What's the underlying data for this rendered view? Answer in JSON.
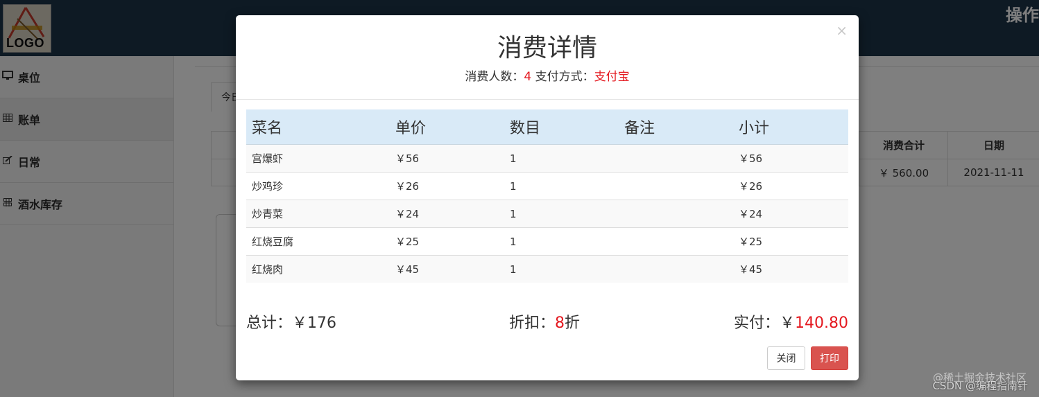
{
  "app": {
    "logo_text": "LOGO",
    "top_action": "操作"
  },
  "sidebar": {
    "items": [
      {
        "label": "桌位",
        "icon": "monitor-icon"
      },
      {
        "label": "账单",
        "icon": "table-icon"
      },
      {
        "label": "日常",
        "icon": "edit-icon"
      },
      {
        "label": "酒水库存",
        "icon": "barcode-icon"
      }
    ]
  },
  "main": {
    "tab_label": "今日",
    "table": {
      "headers": [
        "消费合计",
        "日期"
      ],
      "row": [
        "￥ 560.00",
        "2021-11-11"
      ]
    }
  },
  "modal": {
    "title": "消费详情",
    "people_label": "消费人数：",
    "people_value": "4",
    "pay_label": "支付方式：",
    "pay_value": "支付宝",
    "close_symbol": "×",
    "columns": [
      "菜名",
      "单价",
      "数目",
      "备注",
      "小计"
    ],
    "rows": [
      {
        "name": "宫爆虾",
        "price": "￥56",
        "qty": "1",
        "note": "",
        "subtotal": "￥56"
      },
      {
        "name": "炒鸡珍",
        "price": "￥26",
        "qty": "1",
        "note": "",
        "subtotal": "￥26"
      },
      {
        "name": "炒青菜",
        "price": "￥24",
        "qty": "1",
        "note": "",
        "subtotal": "￥24"
      },
      {
        "name": "红烧豆腐",
        "price": "￥25",
        "qty": "1",
        "note": "",
        "subtotal": "￥25"
      },
      {
        "name": "红烧肉",
        "price": "￥45",
        "qty": "1",
        "note": "",
        "subtotal": "￥45"
      }
    ],
    "total_label": "总计：",
    "total_value": "￥176",
    "discount_label": "折扣：",
    "discount_value": "8",
    "discount_unit": "折",
    "paid_label": "实付：",
    "paid_currency": "￥",
    "paid_value": "140.80",
    "close_button": "关闭",
    "print_button": "打印"
  },
  "watermark": {
    "line1": "@稀土掘金技术社区",
    "line2": "CSDN @编程指南针"
  },
  "colors": {
    "topbar": "#1d3448",
    "accent_red": "#e4181f",
    "table_header": "#d9eaf7",
    "print_button": "#d9534f"
  }
}
